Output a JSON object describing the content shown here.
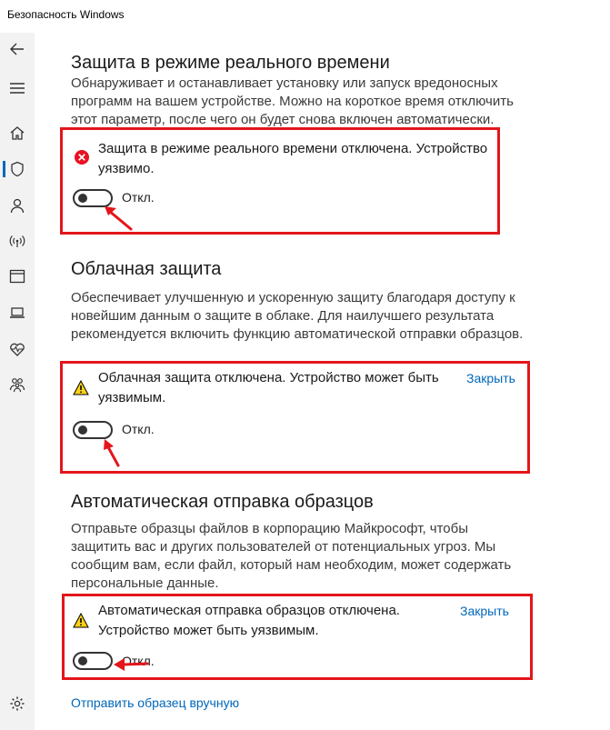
{
  "window": {
    "title": "Безопасность Windows"
  },
  "sidebar": {
    "items": [
      {
        "name": "back-icon"
      },
      {
        "name": "menu-icon"
      },
      {
        "name": "home-icon"
      },
      {
        "name": "shield-icon",
        "active": true
      },
      {
        "name": "account-icon"
      },
      {
        "name": "network-icon"
      },
      {
        "name": "app-browser-icon"
      },
      {
        "name": "device-security-icon"
      },
      {
        "name": "device-health-icon"
      },
      {
        "name": "family-icon"
      },
      {
        "name": "settings-icon"
      }
    ]
  },
  "realtime": {
    "title": "Защита в режиме реального времени",
    "description": "Обнаруживает и останавливает установку или запуск вредоносных программ на вашем устройстве. Можно на короткое время отключить этот параметр, после чего он будет снова включен автоматически.",
    "alert_text": "Защита в режиме реального времени отключена. Устройство уязвимо.",
    "toggle_label": "Откл.",
    "toggle_on": false
  },
  "cloud": {
    "title": "Облачная защита",
    "description": "Обеспечивает улучшенную и ускоренную защиту благодаря доступу к новейшим данным о защите в облаке. Для наилучшего результата рекомендуется включить функцию автоматической отправки образцов.",
    "alert_text": "Облачная защита отключена. Устройство может быть уязвимым.",
    "close_label": "Закрыть",
    "toggle_label": "Откл.",
    "toggle_on": false
  },
  "samples": {
    "title": "Автоматическая отправка образцов",
    "description": "Отправьте образцы файлов в корпорацию Майкрософт, чтобы защитить вас и других пользователей от потенциальных угроз. Мы сообщим вам, если файл, который нам необходим, может содержать персональные данные.",
    "alert_text": "Автоматическая отправка образцов отключена. Устройство может быть уязвимым.",
    "close_label": "Закрыть",
    "toggle_label": "Откл.",
    "toggle_on": false,
    "manual_link": "Отправить образец вручную"
  },
  "colors": {
    "accent": "#0067b8",
    "highlight": "#e3161b",
    "error": "#e81123",
    "warning": "#fcd116"
  }
}
